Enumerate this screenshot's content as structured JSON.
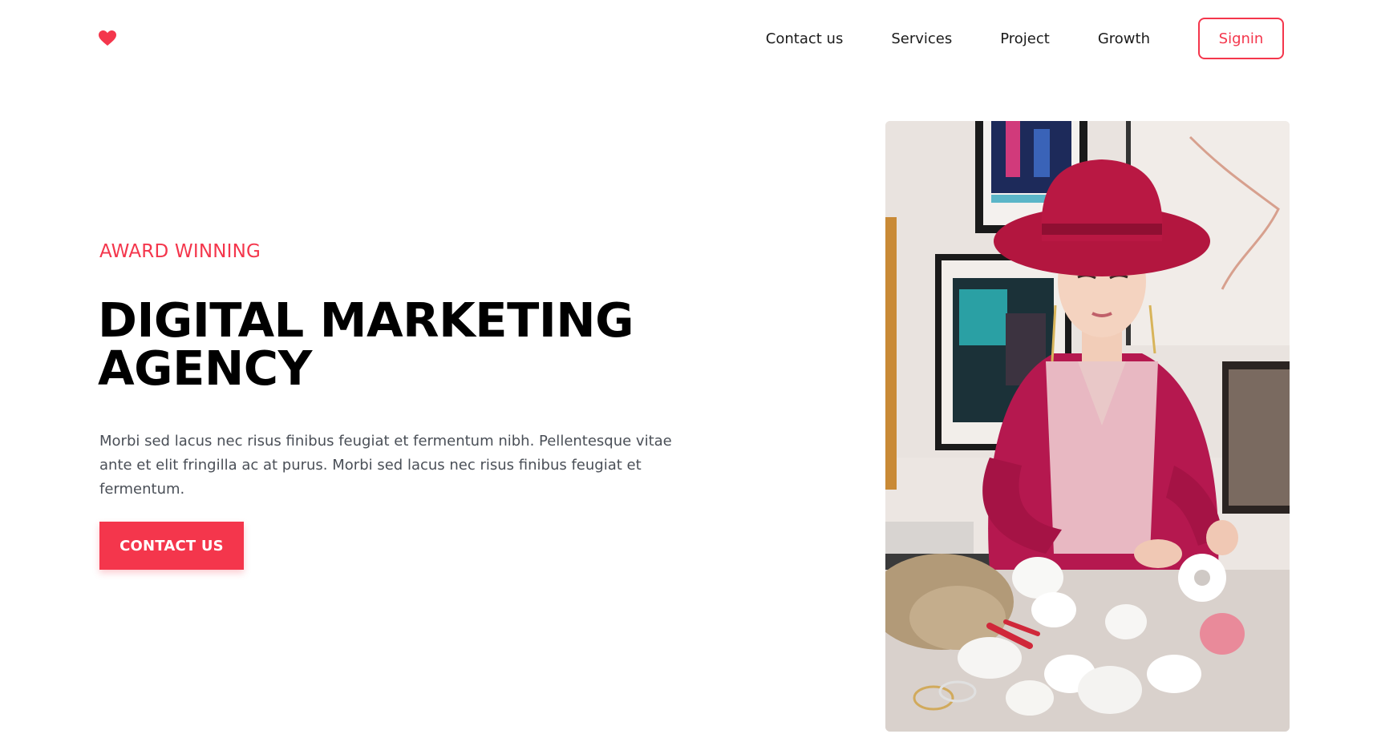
{
  "header": {
    "logo_icon": "heart-icon",
    "nav": [
      {
        "label": "Contact us"
      },
      {
        "label": "Services"
      },
      {
        "label": "Project"
      },
      {
        "label": "Growth"
      }
    ],
    "signin_label": "Signin"
  },
  "hero": {
    "eyebrow": "AWARD WINNING",
    "headline_line1": "DIGITAL MARKETING",
    "headline_line2": "AGENCY",
    "body": "Morbi sed lacus nec risus finibus feugiat et fermentum nibh. Pellentesque vitae ante et elit fringilla ac at purus. Morbi sed lacus nec risus finibus feugiat et fermentum.",
    "cta_label": "CONTACT US",
    "photo_icon": "hero-photo"
  },
  "colors": {
    "accent": "#f4364c",
    "text": "#000000",
    "muted_text": "#4a4f57"
  }
}
